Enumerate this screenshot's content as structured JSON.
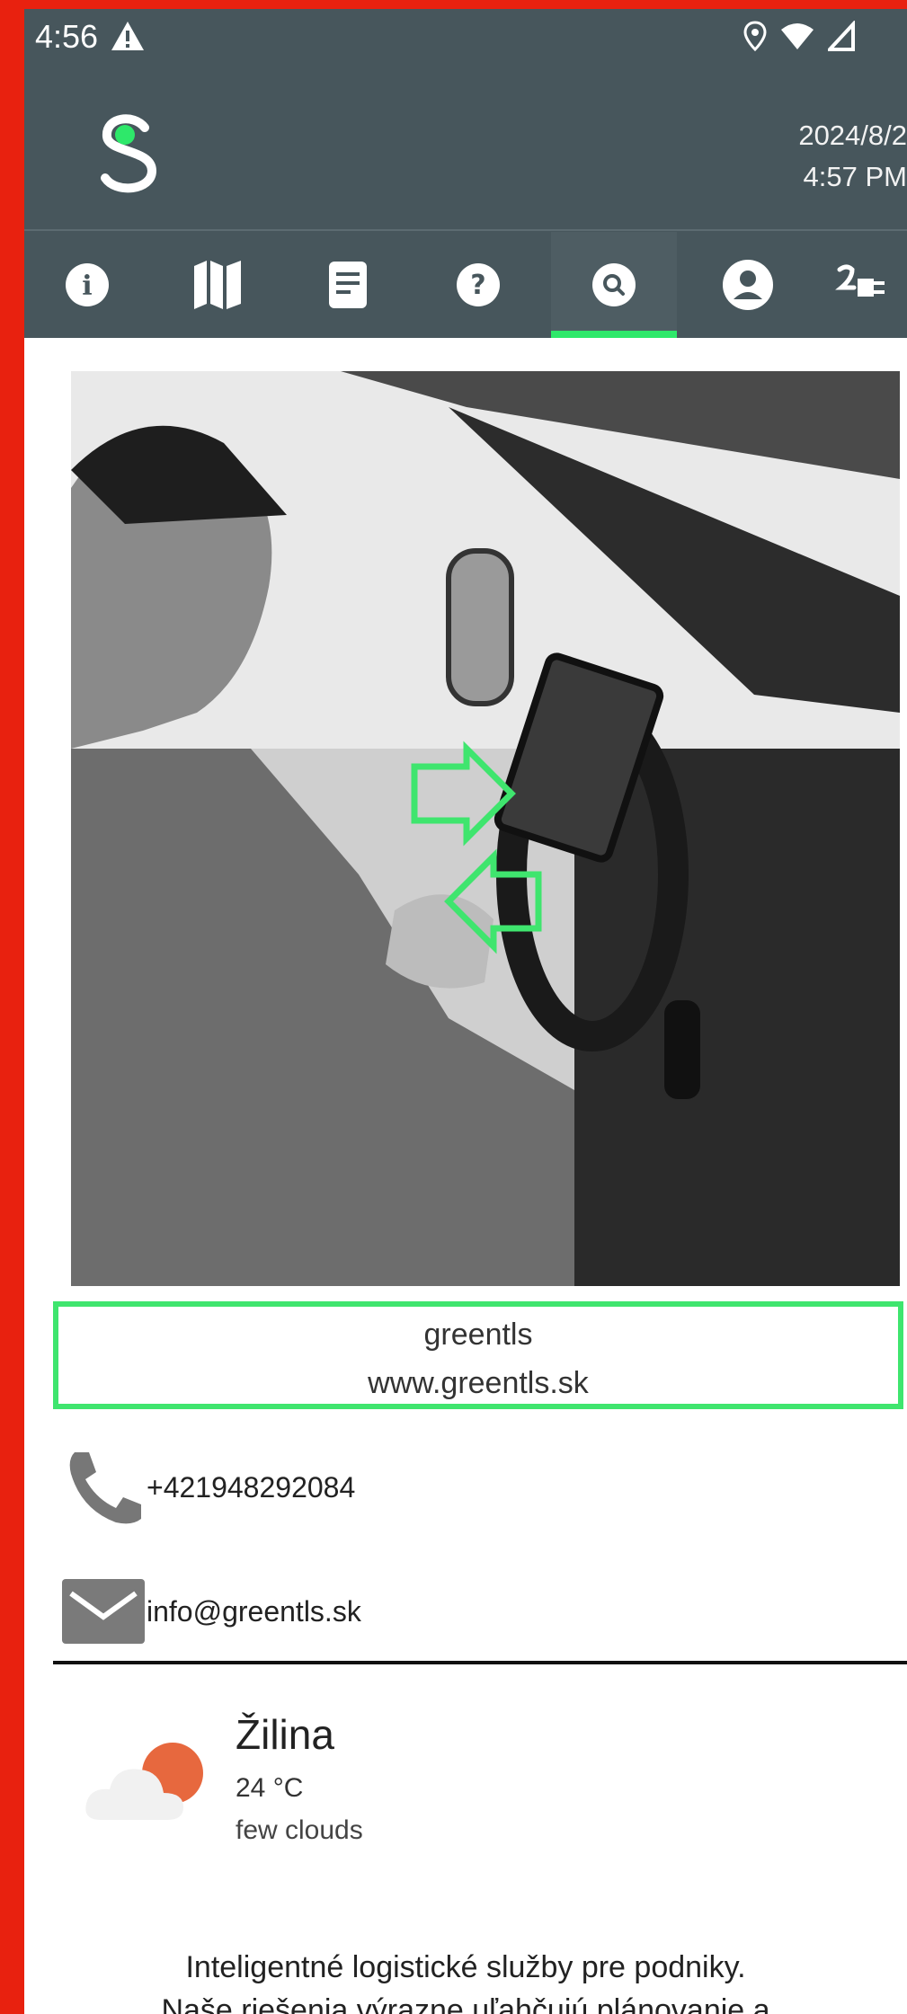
{
  "status_bar": {
    "time": "4:56"
  },
  "header": {
    "date": "2024/8/2",
    "time": "4:57 PM"
  },
  "tabs": [
    {
      "icon": "info-icon",
      "active": false
    },
    {
      "icon": "map-icon",
      "active": false
    },
    {
      "icon": "document-icon",
      "active": false
    },
    {
      "icon": "help-icon",
      "active": false
    },
    {
      "icon": "search-icon",
      "active": true
    },
    {
      "icon": "account-icon",
      "active": false
    },
    {
      "icon": "plug-icon",
      "active": false
    }
  ],
  "company": {
    "name": "greentls",
    "website": "www.greentls.sk"
  },
  "contacts": {
    "phone": "+421948292084",
    "email": "info@greentls.sk"
  },
  "weather": {
    "city": "Žilina",
    "temperature": "24 °C",
    "description": "few clouds"
  },
  "tagline": {
    "line1": "Inteligentné logistické služby pre podniky.",
    "line2": "Naše riešenia výrazne uľahčujú plánovanie a"
  },
  "colors": {
    "header_bg": "#47565c",
    "accent": "#2ee86a",
    "frame": "#e8210f"
  }
}
